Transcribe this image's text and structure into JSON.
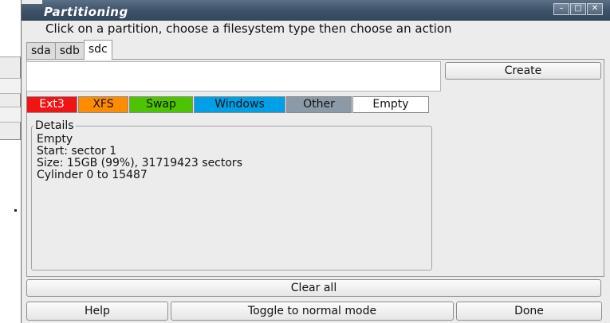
{
  "window": {
    "title": "Partitioning",
    "controls": [
      "minimize-icon",
      "maximize-icon",
      "close-icon"
    ]
  },
  "instruction": "Click on a partition, choose a filesystem type then choose an action",
  "tabs": [
    {
      "label": "sda",
      "active": false
    },
    {
      "label": "sdb",
      "active": false
    },
    {
      "label": "sdc",
      "active": true
    }
  ],
  "actions": {
    "create": "Create",
    "clear_all": "Clear all",
    "help": "Help",
    "toggle_mode": "Toggle to normal mode",
    "done": "Done"
  },
  "filesystems": [
    {
      "label": "Ext3",
      "color": "#f01414"
    },
    {
      "label": "XFS",
      "color": "#ff8c00"
    },
    {
      "label": "Swap",
      "color": "#4cc400"
    },
    {
      "label": "Windows",
      "color": "#00a0e6"
    },
    {
      "label": "Other",
      "color": "#8c9aa8"
    },
    {
      "label": "Empty",
      "color": "#ffffff"
    }
  ],
  "details": {
    "legend": "Details",
    "lines": [
      "Empty",
      "Start: sector 1",
      "Size: 15GB (99%), 31719423 sectors",
      "Cylinder 0 to 15487"
    ]
  }
}
